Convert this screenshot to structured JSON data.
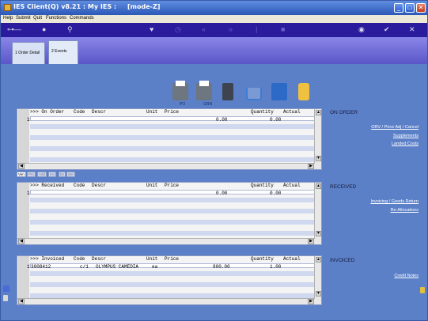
{
  "window": {
    "title": "IES Client(Q) v8.21 : My IES :     [mode-Z]",
    "minimize": "_",
    "maximize": "□",
    "close": "✕"
  },
  "menu": [
    "Help",
    "Submit",
    "Quit",
    "Functions",
    "Commands"
  ],
  "toolbar_icons": [
    "key-icon",
    "help-icon",
    "search-icon",
    "heart-icon",
    "clock-icon",
    "rewind-icon",
    "fast-forward-icon",
    "pipe-icon",
    "stop-icon",
    "user-icon",
    "check-icon",
    "close-icon"
  ],
  "tabs": [
    {
      "label": "1 Order Detail"
    },
    {
      "label": "2 Events"
    }
  ],
  "toolbox": {
    "po_label": "PO",
    "grn_label": "GRN"
  },
  "on_order": {
    "headers": {
      "col1": ">>> On Order",
      "code": "Code",
      "descr": "Descr",
      "unit": "Unit",
      "price": "Price",
      "quantity": "Quantity",
      "actual": "Actual"
    },
    "rows": [
      {
        "num": "1",
        "code": "",
        "descr": "",
        "unit": "",
        "price": "0.00",
        "quantity": "0.00"
      }
    ]
  },
  "small_tabs": [
    "Ven",
    "Pro",
    "Add",
    "Inc",
    "Ex",
    "Sel"
  ],
  "received": {
    "headers": {
      "col1": ">>> Received",
      "code": "Code",
      "descr": "Descr",
      "unit": "Unit",
      "price": "Price",
      "quantity": "Quantity",
      "actual": "Actual"
    },
    "rows": [
      {
        "num": "1",
        "code": "",
        "descr": "",
        "unit": "",
        "price": "0.00",
        "quantity": "0.00"
      }
    ]
  },
  "invoiced": {
    "headers": {
      "col1": ">>> Invoiced",
      "code": "Code",
      "descr": "Descr",
      "unit": "Unit",
      "price": "Price",
      "quantity": "Quantity",
      "actual": "Actual"
    },
    "rows": [
      {
        "num": "1",
        "code": "3008412",
        "code2": "c/1",
        "descr": "OLYMPUS CAMEDIA",
        "unit": "ea",
        "price": "800.00",
        "quantity": "1.00"
      }
    ]
  },
  "side_on_order": {
    "heading": "ON ORDER",
    "links": [
      "ORV / Price Adj / Cancel",
      "Supplements",
      "Landed Costs"
    ]
  },
  "side_received": {
    "heading": "RECEIVED",
    "links": [
      "Invoicing / Goods Return",
      "Re-Allocations"
    ]
  },
  "side_invoiced": {
    "heading": "INVOICED",
    "links": [
      "Credit Notes"
    ]
  }
}
